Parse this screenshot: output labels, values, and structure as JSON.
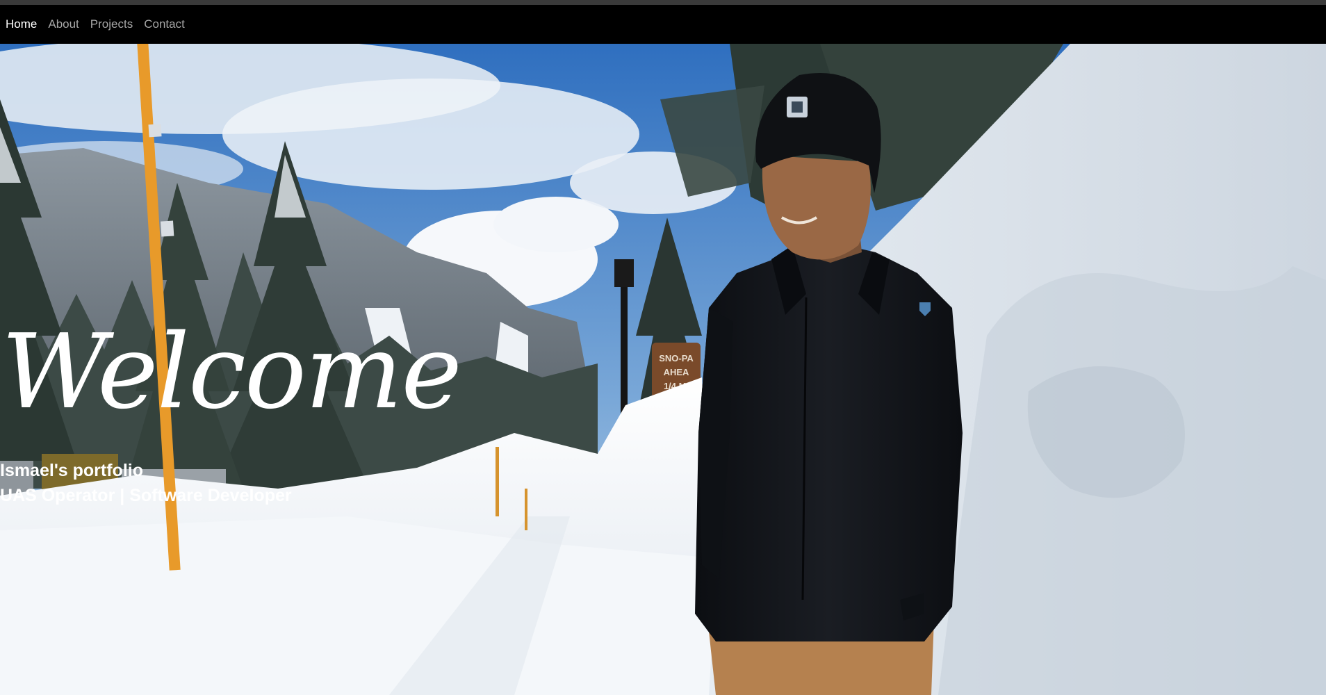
{
  "nav": {
    "items": [
      {
        "label": "Home",
        "active": true
      },
      {
        "label": "About",
        "active": false
      },
      {
        "label": "Projects",
        "active": false
      },
      {
        "label": "Contact",
        "active": false
      }
    ]
  },
  "hero": {
    "title": "Welcome",
    "subtitle": "Ismael's portfolio",
    "role": "UAS Operator | Software Developer",
    "image": "snowy-mountain-photo",
    "sign_text": "SNO-PA AHEA 1/4 MI"
  },
  "colors": {
    "nav_background": "#000000",
    "nav_active": "#ffffff",
    "nav_inactive": "#a6a6a6",
    "sky": "#3d7bc4",
    "snow": "#f2f5f8",
    "jacket": "#12151a",
    "pants": "#b5814f"
  }
}
